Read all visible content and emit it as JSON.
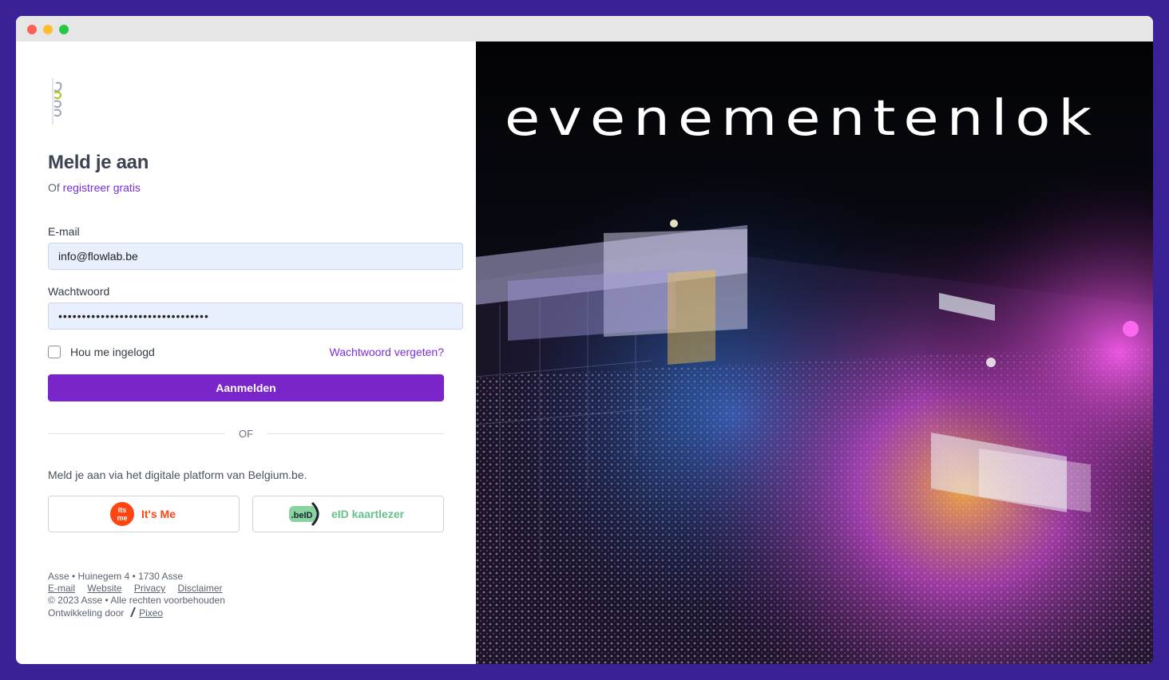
{
  "login": {
    "title": "Meld je aan",
    "subtitle_prefix": "Of",
    "register_link": "registreer gratis",
    "email_label": "E-mail",
    "email_value": "info@flowlab.be",
    "password_label": "Wachtwoord",
    "password_value": "••••••••••••••••••••••••••••••••",
    "remember_label": "Hou me ingelogd",
    "forgot_link": "Wachtwoord vergeten?",
    "submit_label": "Aanmelden",
    "or_label": "OF",
    "platform_text": "Meld je aan via het digitale platform van Belgium.be.",
    "itsme_label": "It's Me",
    "itsme_logo_text": "its me",
    "eid_label": "eID kaartlezer",
    "eid_logo_text": ".beID"
  },
  "footer": {
    "address": "Asse • Huinegem 4 • 1730 Asse",
    "links": [
      "E-mail",
      "Website",
      "Privacy",
      "Disclaimer"
    ],
    "copyright": "© 2023 Asse • Alle rechten voorbehouden",
    "developed_by": "Ontwikkeling door",
    "developer": "Pixeo"
  },
  "hero": {
    "text": "evenementenlok"
  },
  "colors": {
    "accent": "#7a25c9",
    "link": "#7b2ed6",
    "frame": "#3b2196",
    "itsme": "#ff4612",
    "eid": "#66c28a"
  }
}
